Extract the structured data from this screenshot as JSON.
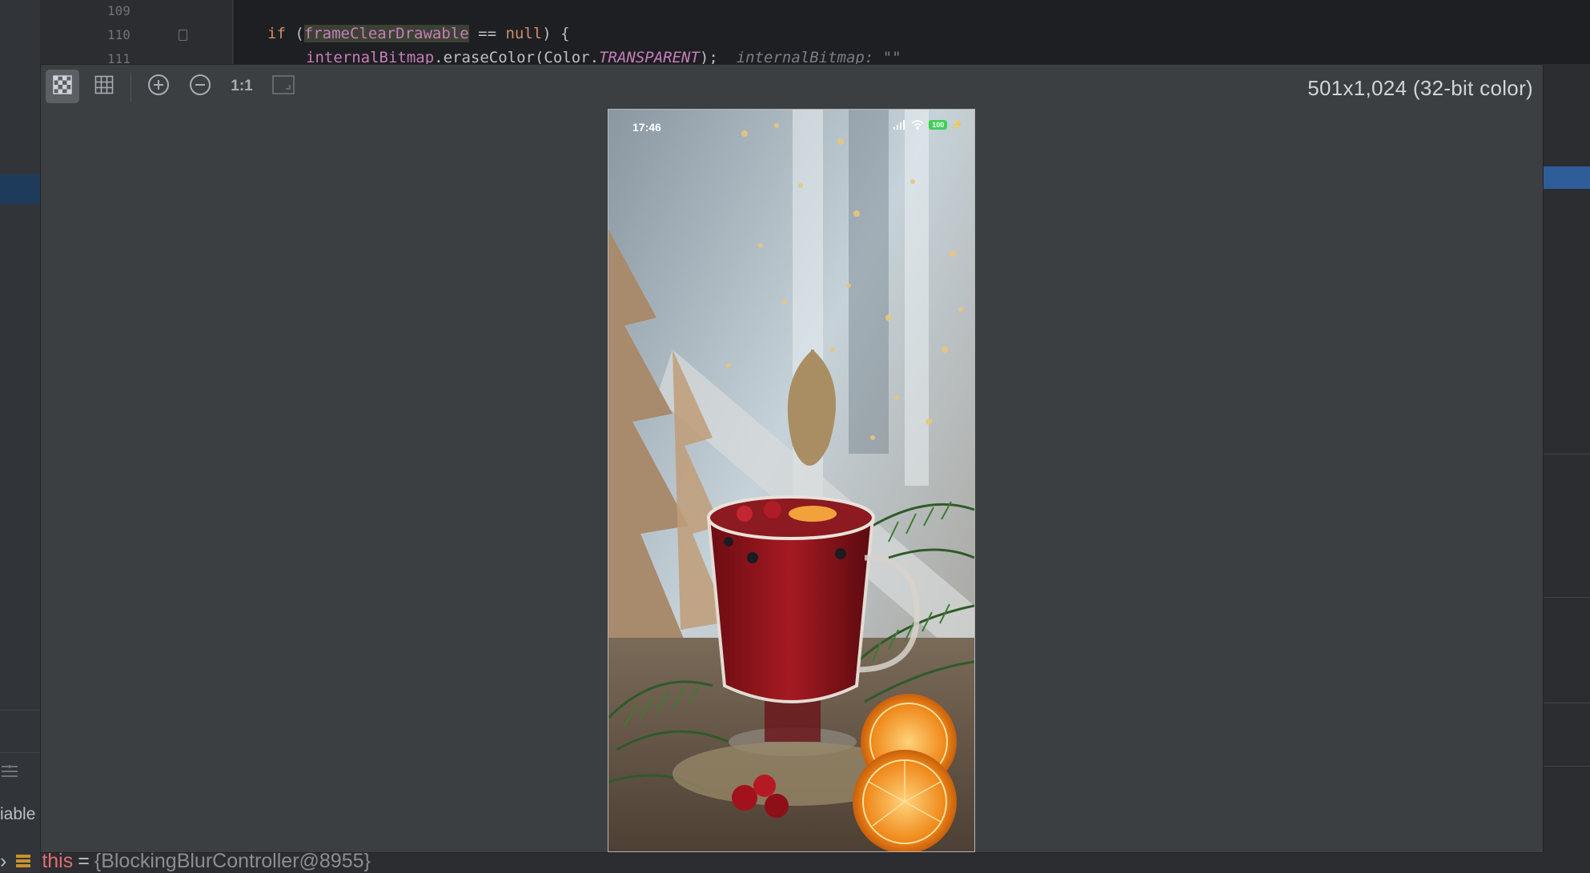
{
  "editor": {
    "line_numbers": [
      "109",
      "110",
      "111"
    ],
    "line_110": {
      "kw_if": "if",
      "open": " (",
      "identifier": "frameClearDrawable",
      "op": " == ",
      "null_kw": "null",
      "close": ") {"
    },
    "line_111": {
      "field": "internalBitmap",
      "method": ".eraseColor(Color.",
      "constant": "TRANSPARENT",
      "tail": ");",
      "hint": "internalBitmap: \"\""
    }
  },
  "sidebar": {
    "partial_label": "iable"
  },
  "debug_row": {
    "name": "this",
    "equals": "=",
    "value": "{BlockingBlurController@8955}"
  },
  "viewer": {
    "dimensions_label": "501x1,024  (32-bit color)",
    "toolbar": [
      {
        "name": "chessboard",
        "icon": "chessboard-icon",
        "active": true
      },
      {
        "name": "grid",
        "icon": "grid-icon",
        "active": false
      },
      {
        "name": "zoom-in",
        "icon": "zoom-in-icon",
        "active": false
      },
      {
        "name": "zoom-out",
        "icon": "zoom-out-icon",
        "active": false
      },
      {
        "name": "actual-size",
        "label": "1:1",
        "active": false
      },
      {
        "name": "fit-window",
        "icon": "fit-window-icon",
        "active": false
      }
    ],
    "image": {
      "status_time": "17:46",
      "battery": "100"
    }
  },
  "colors": {
    "viewer_bg": "#3c3f41",
    "keyword": "#cf8e6d",
    "field": "#c77dbb",
    "selection": "#2e5d99"
  }
}
